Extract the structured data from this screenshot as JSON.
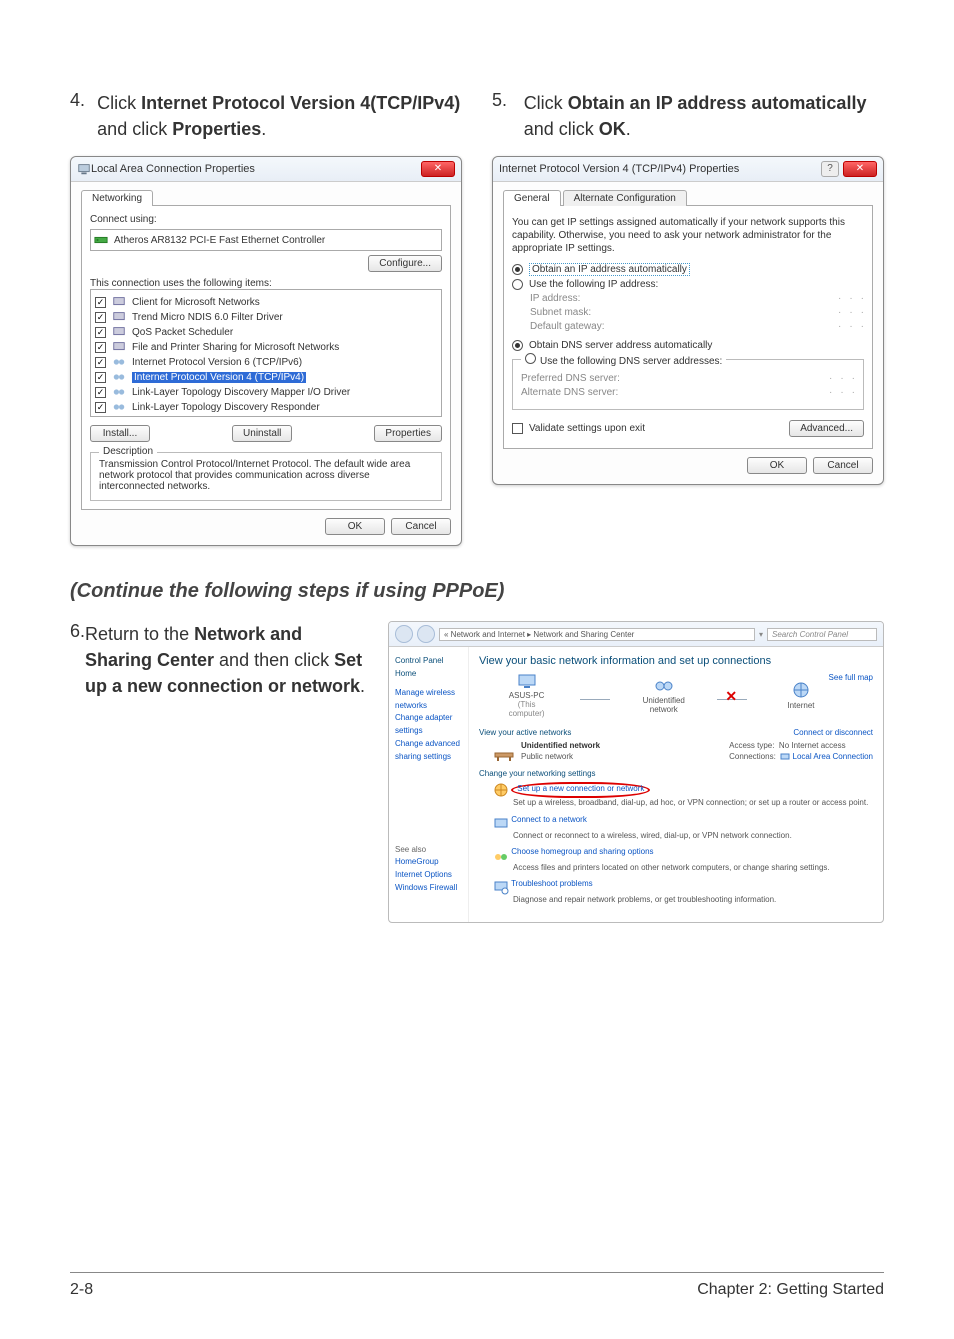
{
  "steps": {
    "s4": {
      "num": "4.",
      "text_pre": "Click ",
      "b1": "Internet Protocol Version 4(TCP/IPv4)",
      "text_mid": " and click ",
      "b2": "Properties",
      "text_post": "."
    },
    "s5": {
      "num": "5.",
      "text_pre": "Click ",
      "b1": "Obtain an IP address automatically",
      "text_mid": " and click ",
      "b2": "OK",
      "text_post": "."
    },
    "s6": {
      "num": "6.",
      "text_pre": "Return to the ",
      "b1": "Network and Sharing Center",
      "text_mid": " and then click ",
      "b2": "Set up a new connection or network",
      "text_post": "."
    }
  },
  "continue_heading": "(Continue the following steps if using PPPoE)",
  "lan_dialog": {
    "title": "Local Area Connection Properties",
    "tab": "Networking",
    "connect_using_label": "Connect using:",
    "adapter": "Atheros AR8132 PCI-E Fast Ethernet Controller",
    "configure_btn": "Configure...",
    "uses_label": "This connection uses the following items:",
    "items": [
      "Client for Microsoft Networks",
      "Trend Micro NDIS 6.0 Filter Driver",
      "QoS Packet Scheduler",
      "File and Printer Sharing for Microsoft Networks",
      "Internet Protocol Version 6 (TCP/IPv6)",
      "Internet Protocol Version 4 (TCP/IPv4)",
      "Link-Layer Topology Discovery Mapper I/O Driver",
      "Link-Layer Topology Discovery Responder"
    ],
    "install_btn": "Install...",
    "uninstall_btn": "Uninstall",
    "properties_btn": "Properties",
    "desc_legend": "Description",
    "desc_text": "Transmission Control Protocol/Internet Protocol. The default wide area network protocol that provides communication across diverse interconnected networks.",
    "ok_btn": "OK",
    "cancel_btn": "Cancel",
    "close_x": "✕"
  },
  "ipv4_dialog": {
    "title": "Internet Protocol Version 4 (TCP/IPv4) Properties",
    "tab_general": "General",
    "tab_alt": "Alternate Configuration",
    "note": "You can get IP settings assigned automatically if your network supports this capability. Otherwise, you need to ask your network administrator for the appropriate IP settings.",
    "r_auto_ip": "Obtain an IP address automatically",
    "r_use_ip": "Use the following IP address:",
    "ip_addr": "IP address:",
    "subnet": "Subnet mask:",
    "gateway": "Default gateway:",
    "r_auto_dns": "Obtain DNS server address automatically",
    "r_use_dns": "Use the following DNS server addresses:",
    "pref_dns": "Preferred DNS server:",
    "alt_dns": "Alternate DNS server:",
    "validate": "Validate settings upon exit",
    "advanced_btn": "Advanced...",
    "ok_btn": "OK",
    "cancel_btn": "Cancel",
    "qmark": "?",
    "close_x": "✕"
  },
  "sharing": {
    "breadcrumb": "« Network and Internet ▸ Network and Sharing Center",
    "search_ph": "Search Control Panel",
    "side": {
      "home": "Control Panel Home",
      "wireless": "Manage wireless networks",
      "adapter": "Change adapter settings",
      "advanced": "Change advanced sharing settings",
      "seealso": "See also",
      "homegroup": "HomeGroup",
      "inetopt": "Internet Options",
      "firewall": "Windows Firewall"
    },
    "main": {
      "title": "View your basic network information and set up connections",
      "fullmap": "See full map",
      "node_pc": "ASUS-PC",
      "node_pc_sub": "(This computer)",
      "node_unid": "Unidentified network",
      "node_internet": "Internet",
      "active_label": "View your active networks",
      "connect_link": "Connect or disconnect",
      "card_title": "Unidentified network",
      "card_sub": "Public network",
      "access_lbl": "Access type:",
      "access_val": "No Internet access",
      "conn_lbl": "Connections:",
      "conn_val": "Local Area Connection",
      "change_label": "Change your networking settings",
      "opt1_t": "Set up a new connection or network",
      "opt1_d": "Set up a wireless, broadband, dial-up, ad hoc, or VPN connection; or set up a router or access point.",
      "opt2_t": "Connect to a network",
      "opt2_d": "Connect or reconnect to a wireless, wired, dial-up, or VPN network connection.",
      "opt3_t": "Choose homegroup and sharing options",
      "opt3_d": "Access files and printers located on other network computers, or change sharing settings.",
      "opt4_t": "Troubleshoot problems",
      "opt4_d": "Diagnose and repair network problems, or get troubleshooting information."
    }
  },
  "footer": {
    "left": "2-8",
    "right": "Chapter 2: Getting Started"
  }
}
